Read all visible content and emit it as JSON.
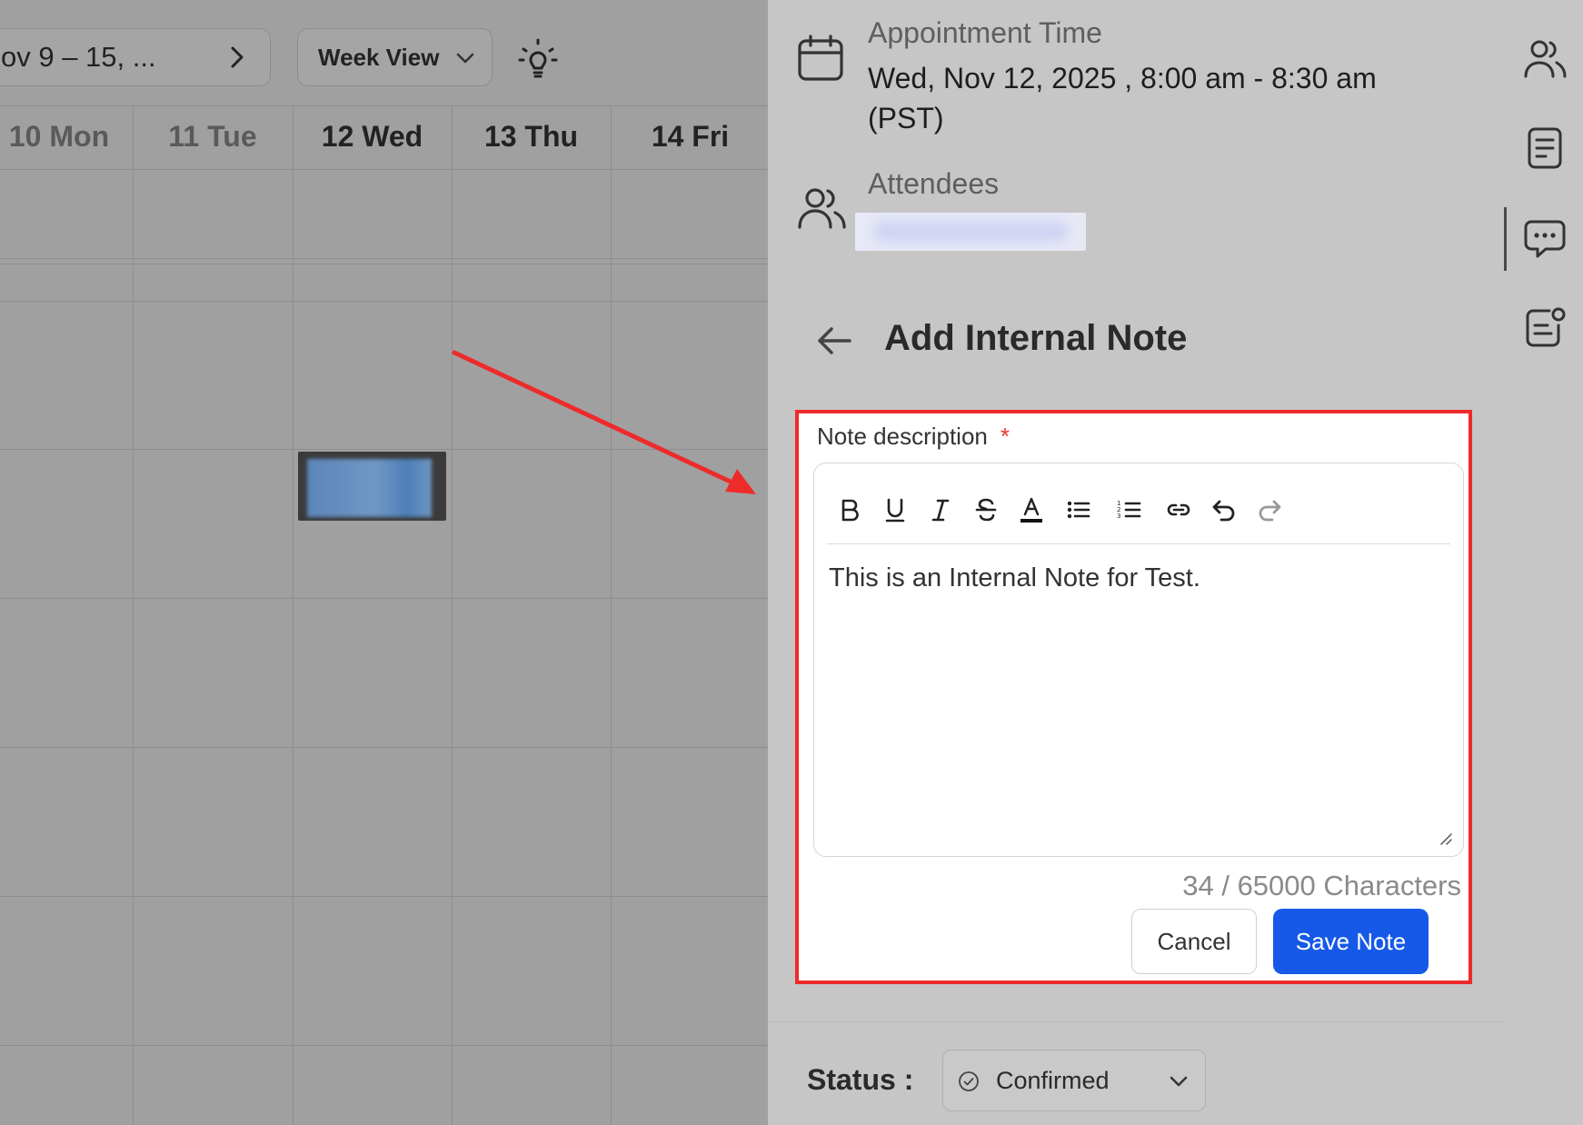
{
  "calendar": {
    "range_label": "ov 9 – 15, ...",
    "view_label": "Week View",
    "days": [
      "10 Mon",
      "11 Tue",
      "12 Wed",
      "13 Thu",
      "14 Fri"
    ]
  },
  "appointment": {
    "time_label": "Appointment Time",
    "time_value": "Wed, Nov 12, 2025 , 8:00 am - 8:30 am (PST)",
    "attendees_label": "Attendees"
  },
  "note": {
    "title": "Add Internal Note",
    "field_label": "Note description",
    "required_mark": "*",
    "text": "This is an Internal Note for Test.",
    "char_count": "34 / 65000 Characters",
    "cancel_label": "Cancel",
    "save_label": "Save Note"
  },
  "status": {
    "label": "Status :",
    "value": "Confirmed"
  },
  "colors": {
    "primary": "#1659e8",
    "highlight": "#ee2b2b"
  }
}
